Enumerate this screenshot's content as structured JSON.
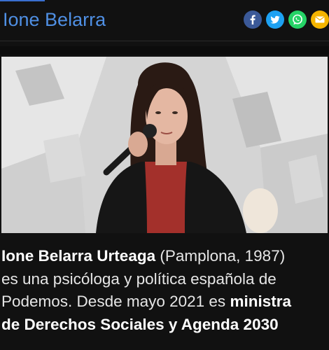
{
  "header": {
    "title": "Ione Belarra",
    "accent_color": "#4f8fe3"
  },
  "share": [
    {
      "name": "facebook-icon",
      "color": "#3b5998"
    },
    {
      "name": "twitter-icon",
      "color": "#1da1f2"
    },
    {
      "name": "whatsapp-icon",
      "color": "#25d366"
    },
    {
      "name": "email-icon",
      "color": "#f4b400"
    }
  ],
  "photo": {
    "subject": "person-speaking-into-microphone"
  },
  "bio": {
    "name_bold": "Ione Belarra Urteaga",
    "line1_rest": " (Pamplona, 1987)",
    "line2": "es una psicóloga y política española de",
    "line3_start": "Podemos. Desde mayo 2021 es ",
    "line3_bold": "ministra",
    "line4_bold": "de Derechos Sociales y Agenda 2030"
  }
}
